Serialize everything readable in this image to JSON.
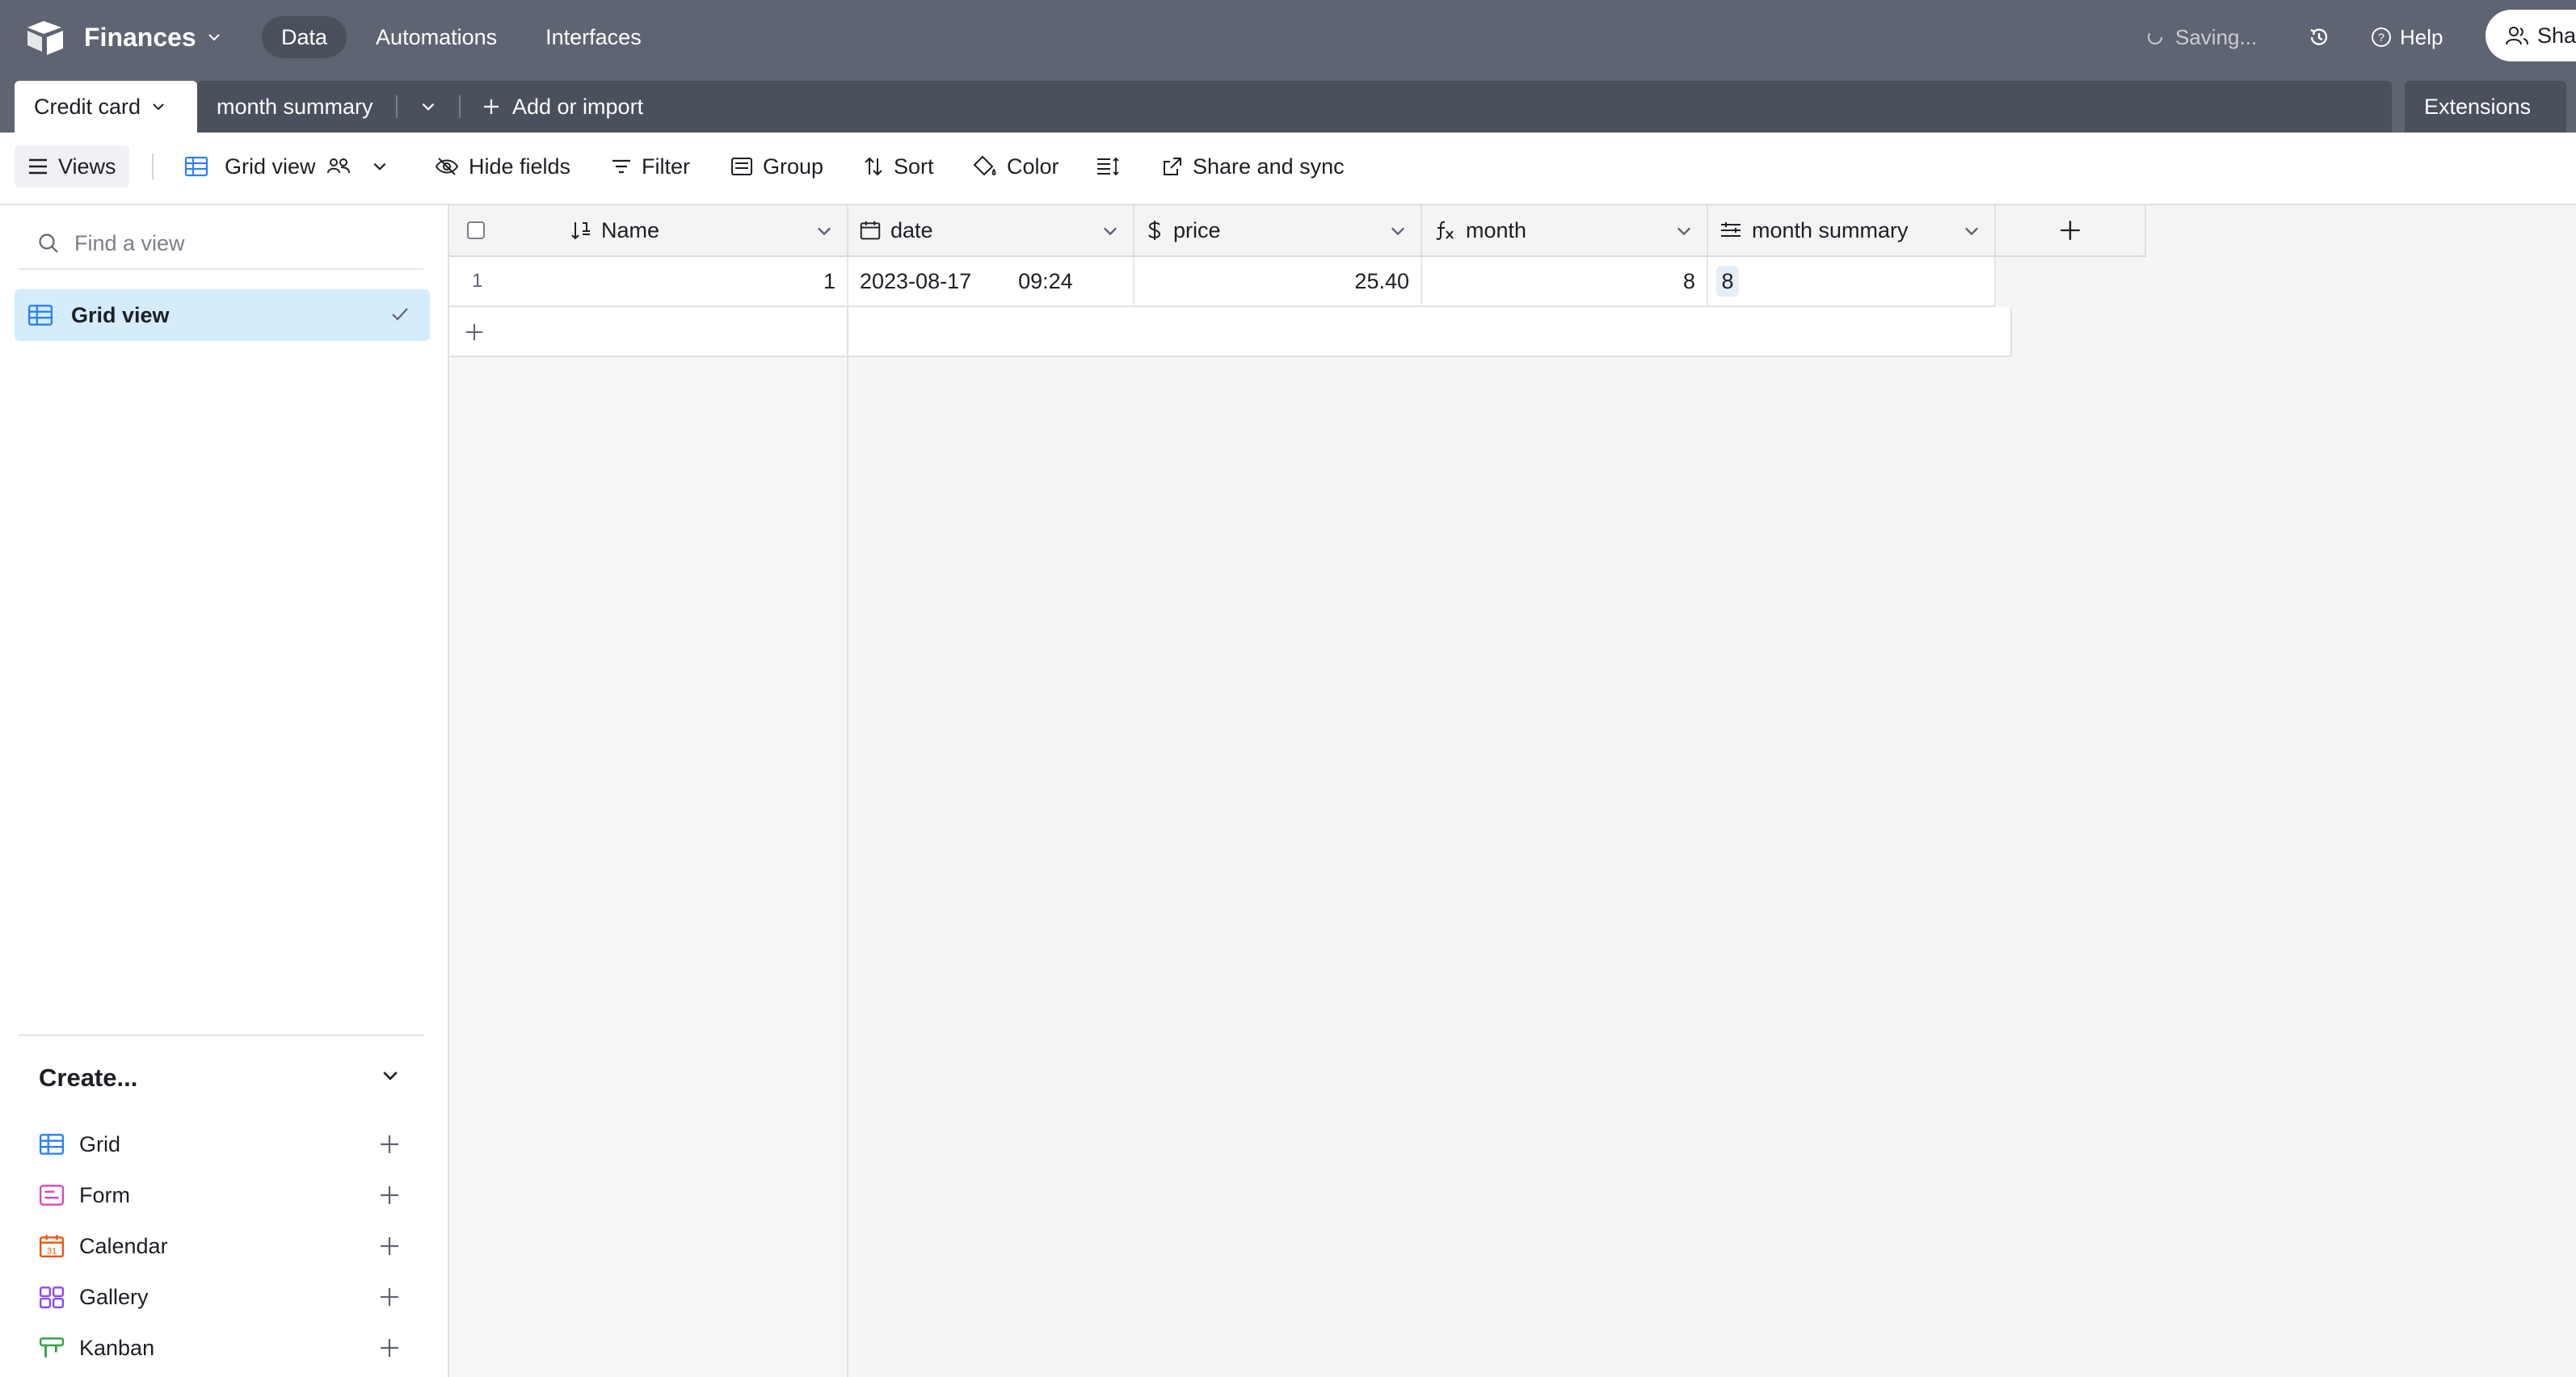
{
  "app": {
    "base_name": "Finances",
    "nav": {
      "data": "Data",
      "automations": "Automations",
      "interfaces": "Interfaces"
    },
    "status": "Saving...",
    "help": "Help",
    "share": "Share"
  },
  "tabs": {
    "active": "Credit card",
    "second": "month summary",
    "add_import": "Add or import",
    "extensions": "Extensions"
  },
  "toolbar": {
    "views": "Views",
    "grid_view": "Grid view",
    "hide_fields": "Hide fields",
    "filter": "Filter",
    "group": "Group",
    "sort": "Sort",
    "color": "Color",
    "share_sync": "Share and sync"
  },
  "sidebar": {
    "search_placeholder": "Find a view",
    "active_view": "Grid view",
    "create_title": "Create...",
    "create_items": [
      {
        "label": "Grid",
        "icon": "grid-icon",
        "color": "#2d7ff9"
      },
      {
        "label": "Form",
        "icon": "form-icon",
        "color": "#d946b8"
      },
      {
        "label": "Calendar",
        "icon": "calendar-icon",
        "color": "#e8580c"
      },
      {
        "label": "Gallery",
        "icon": "gallery-icon",
        "color": "#8b46ff"
      },
      {
        "label": "Kanban",
        "icon": "kanban-icon",
        "color": "#2f9e44"
      }
    ]
  },
  "grid": {
    "columns": {
      "name": "Name",
      "date": "date",
      "price": "price",
      "month": "month",
      "month_summary": "month summary"
    },
    "rows": [
      {
        "row_number": "1",
        "name": "1",
        "date": "2023-08-17",
        "time": "09:24",
        "price": "25.40",
        "month": "8",
        "month_summary": "8"
      }
    ]
  },
  "colors": {
    "topbar": "#5f6472",
    "active_view_bg": "#d4ecfb",
    "accent": "#2d7ff9"
  }
}
